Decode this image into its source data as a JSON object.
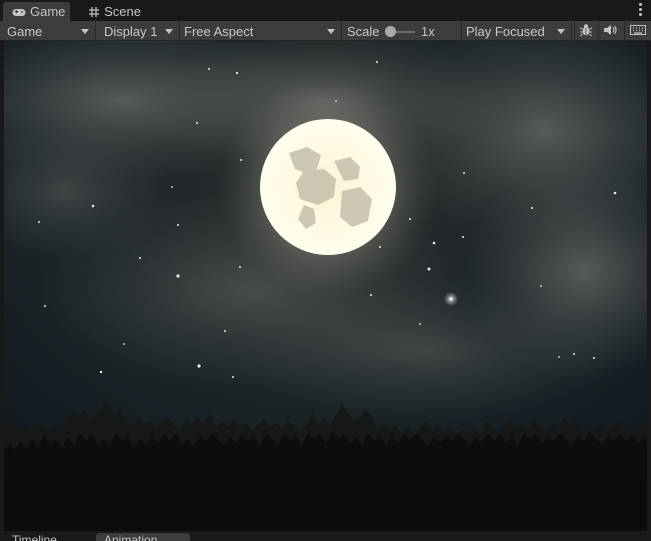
{
  "tabs": [
    {
      "label": "Game",
      "icon": "gamepad-icon",
      "active": true
    },
    {
      "label": "Scene",
      "icon": "grid-icon",
      "active": false
    }
  ],
  "toolbar": {
    "view_select": "Game",
    "display_select": "Display 1",
    "aspect_select": "Free Aspect",
    "scale_label": "Scale",
    "scale_value": "1x",
    "play_mode_select": "Play Focused",
    "icons": [
      "bug-icon",
      "speaker-icon",
      "keyboard-icon"
    ]
  },
  "bottom_tabs": [
    {
      "label": "Timeline",
      "active": false
    },
    {
      "label": "Animation",
      "active": true
    }
  ],
  "colors": {
    "panel": "#3c3c3c",
    "background": "#191919",
    "moon": "#fff8d8",
    "sky": "#11181c"
  }
}
